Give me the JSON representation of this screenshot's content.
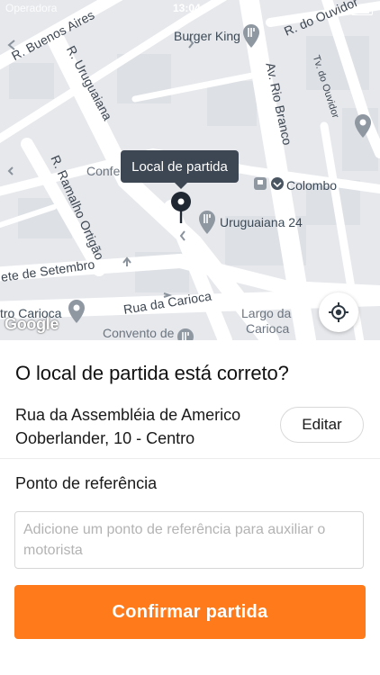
{
  "status_bar": {
    "carrier": "Operadora",
    "time": "13:04"
  },
  "map": {
    "streets": {
      "buenos_aires": "R. Buenos Aires",
      "uruguaiana": "R. Uruguaiana",
      "do_ouvidor": "R. do Ouvidor",
      "tv_do_ouvidor": "Tv. do Ouvidor",
      "rio_branco": "Av. Rio Branco",
      "ramalho_ortigao": "R. Ramalho Ortigão",
      "sete_de_setembro": "ete de Setembro",
      "da_carioca": "Rua da Carioca"
    },
    "pois": {
      "burger_king": "Burger King",
      "colombo": "Colombo",
      "uruguaiana_24": "Uruguaiana 24",
      "confeitaria": "Confe",
      "largo_da_carioca_line1": "Largo da",
      "largo_da_carioca_line2": "Carioca",
      "convento": "Convento de",
      "teatro_carioca": "tro Carioca"
    },
    "tooltip": "Local de partida",
    "attribution": "Google"
  },
  "sheet": {
    "title": "O local de partida está correto?",
    "address": "Rua da Assembléia de Americo Ooberlander, 10 - Centro",
    "edit_label": "Editar",
    "reference_label": "Ponto de referência",
    "reference_placeholder": "Adicione um ponto de referência para auxiliar o motorista",
    "confirm_label": "Confirmar partida"
  },
  "colors": {
    "accent": "#ff7a1a",
    "tooltip_bg": "#3d4653",
    "map_bg": "#e9ebef"
  }
}
